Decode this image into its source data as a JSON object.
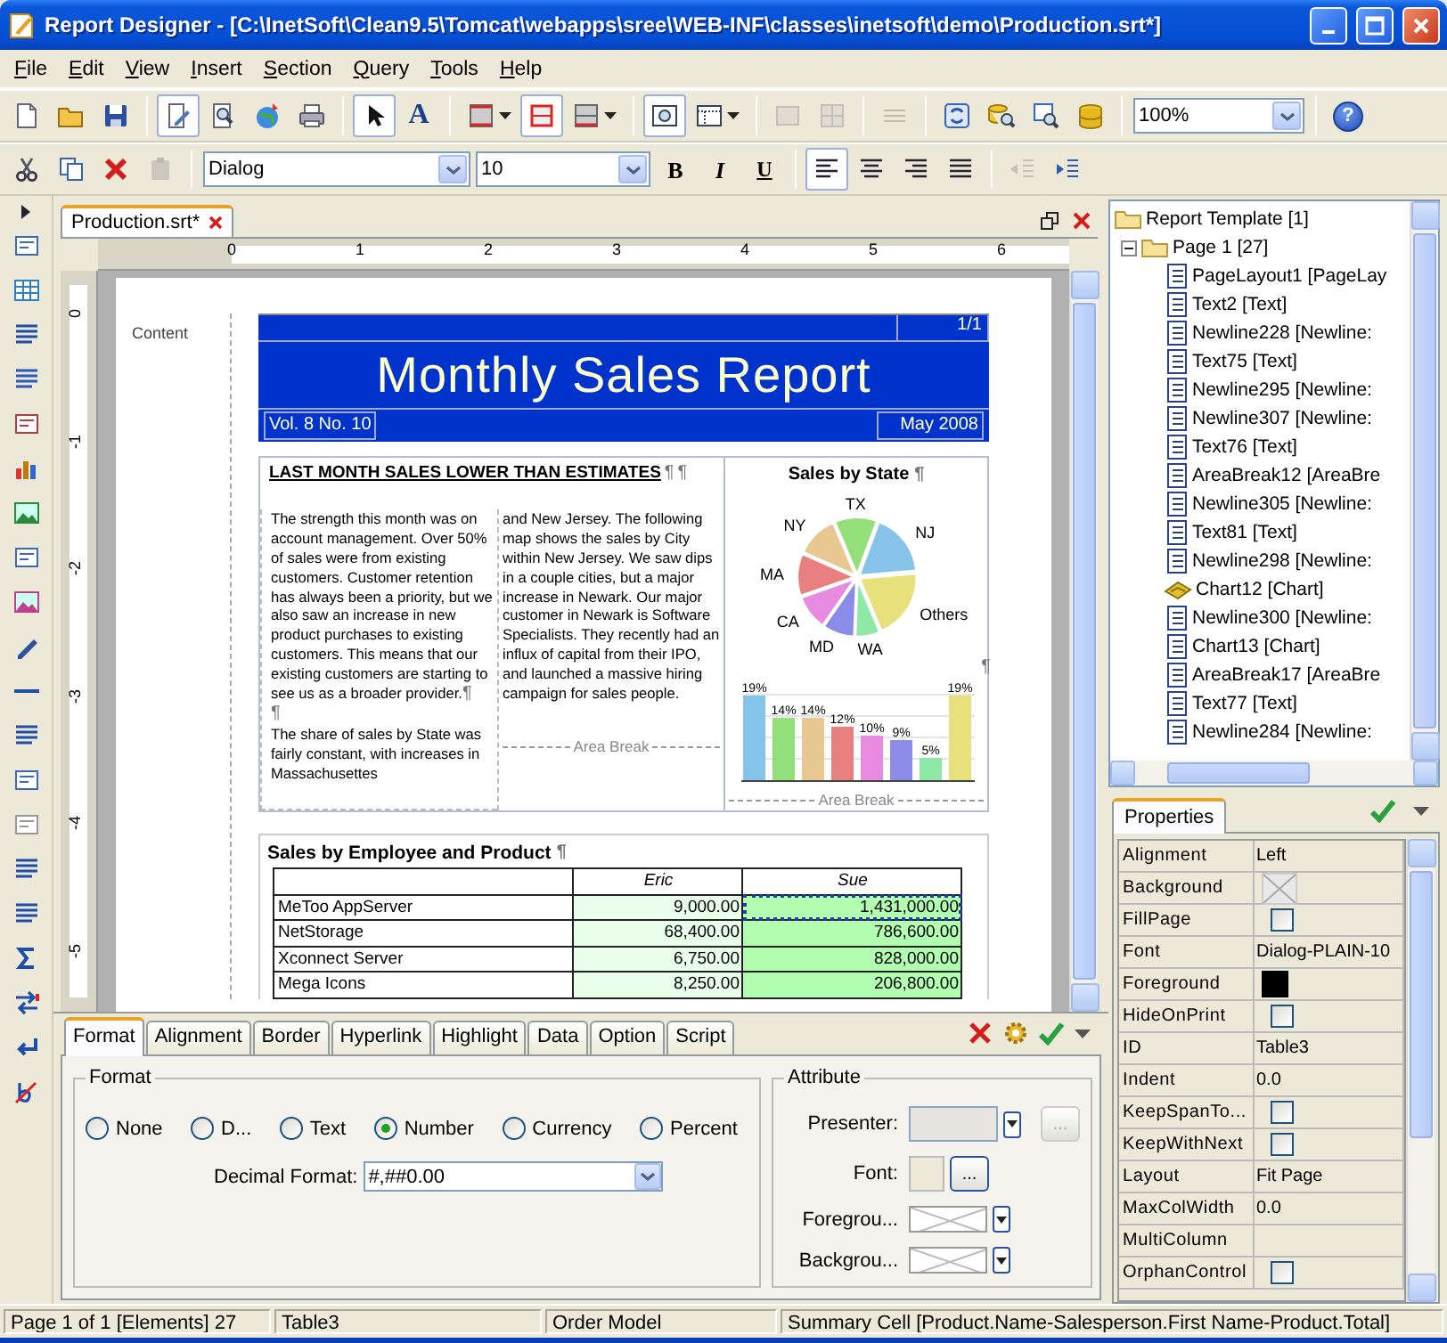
{
  "window": {
    "title": "Report Designer - [C:\\InetSoft\\Clean9.5\\Tomcat\\webapps\\sree\\WEB-INF\\classes\\inetsoft\\demo\\Production.srt*]"
  },
  "menu": [
    "File",
    "Edit",
    "View",
    "Insert",
    "Section",
    "Query",
    "Tools",
    "Help"
  ],
  "toolbar_1": [
    {
      "items": [
        {
          "kind": "new",
          "pressed": false,
          "disabled": false
        },
        {
          "kind": "open",
          "pressed": false,
          "disabled": false
        },
        {
          "kind": "save",
          "pressed": false,
          "disabled": false
        }
      ]
    },
    {
      "items": [
        {
          "kind": "design",
          "pressed": true,
          "disabled": false
        },
        {
          "kind": "preview",
          "pressed": false,
          "disabled": false
        },
        {
          "kind": "export",
          "pressed": false,
          "disabled": false
        },
        {
          "kind": "print",
          "pressed": false,
          "disabled": false
        }
      ]
    },
    {
      "items": [
        {
          "kind": "select",
          "pressed": true,
          "disabled": false
        },
        {
          "kind": "text_tool",
          "glyph": "A",
          "pressed": false,
          "disabled": false
        }
      ]
    },
    {
      "items": [
        {
          "kind": "row_border_menu",
          "pressed": false,
          "disabled": false
        },
        {
          "kind": "border_box",
          "pressed": true,
          "disabled": false
        },
        {
          "kind": "col_border_menu",
          "pressed": false,
          "disabled": false
        }
      ]
    },
    {
      "items": [
        {
          "kind": "preview_frame",
          "pressed": true,
          "disabled": false
        },
        {
          "kind": "layout_menu",
          "pressed": false,
          "disabled": false
        }
      ]
    },
    {
      "items": [
        {
          "kind": "merge",
          "pressed": false,
          "disabled": true
        },
        {
          "kind": "split",
          "pressed": false,
          "disabled": true
        }
      ]
    },
    {
      "items": [
        {
          "kind": "rows",
          "pressed": false,
          "disabled": true
        }
      ]
    },
    {
      "items": [
        {
          "kind": "refresh",
          "pressed": false,
          "disabled": false
        },
        {
          "kind": "query",
          "pressed": false,
          "disabled": false
        },
        {
          "kind": "browse",
          "pressed": false,
          "disabled": false
        },
        {
          "kind": "database",
          "pressed": false,
          "disabled": false
        }
      ]
    },
    {
      "items": [
        {
          "kind": "zoom_combo",
          "value": "100%",
          "pressed": false,
          "disabled": false
        }
      ]
    },
    {
      "items": [
        {
          "kind": "help",
          "glyph": "?",
          "pressed": false,
          "disabled": false
        }
      ]
    }
  ],
  "toolbar_2": [
    {
      "items": [
        {
          "kind": "cut",
          "pressed": false,
          "disabled": false
        },
        {
          "kind": "copy",
          "pressed": false,
          "disabled": false
        },
        {
          "kind": "delete",
          "pressed": false,
          "disabled": false
        },
        {
          "kind": "paste",
          "pressed": false,
          "disabled": true
        }
      ]
    },
    {
      "items": [
        {
          "kind": "font_combo",
          "value": "Dialog",
          "pressed": false,
          "disabled": false
        },
        {
          "kind": "size_combo",
          "value": "10",
          "pressed": false,
          "disabled": false
        },
        {
          "kind": "bold",
          "glyph": "B",
          "pressed": false,
          "disabled": false
        },
        {
          "kind": "italic",
          "glyph": "I",
          "pressed": false,
          "disabled": false
        },
        {
          "kind": "underline",
          "glyph": "U",
          "pressed": false,
          "disabled": false
        }
      ]
    },
    {
      "items": [
        {
          "kind": "align_left",
          "pressed": true,
          "disabled": false
        },
        {
          "kind": "align_center",
          "pressed": false,
          "disabled": false
        },
        {
          "kind": "align_right",
          "pressed": false,
          "disabled": false
        },
        {
          "kind": "justify",
          "pressed": false,
          "disabled": false
        }
      ]
    },
    {
      "items": [
        {
          "kind": "outdent",
          "pressed": false,
          "disabled": true
        },
        {
          "kind": "indent",
          "pressed": false,
          "disabled": false
        }
      ]
    }
  ],
  "editor": {
    "tab": {
      "label": "Production.srt*"
    },
    "ruler": {
      "horizontal": [
        "0",
        "1",
        "2",
        "3",
        "4",
        "5",
        "6"
      ],
      "vertical": [
        "0",
        "-1",
        "-2",
        "-3",
        "-4",
        "-5"
      ]
    },
    "report": {
      "margin_label": "Content",
      "page_number": "1/1",
      "title": "Monthly Sales Report",
      "volume": "Vol. 8 No. 10",
      "date": "May 2008",
      "headline": "LAST MONTH SALES LOWER THAN ESTIMATES",
      "headline_marks": [
        "¶",
        "¶"
      ],
      "column_1": [
        {
          "text": "The strength this month was on account management. Over 50% of sales were from existing customers. Customer retention has always been a priority, but we also saw an increase in new product purchases to existing customers. This means that our existing customers are starting to see us as a broader provider.",
          "mark": "¶"
        },
        {
          "mark": "¶"
        },
        {
          "text": "The share of sales by State was fairly constant, with increases in Massachusettes"
        }
      ],
      "column_2": {
        "text": "and New Jersey. The following map shows the sales by City within New Jersey. We saw dips in a couple cities, but a major increase in Newark. Our major customer in Newark is Software Specialists. They recently had an influx of capital from their IPO, and launched a massive hiring campaign for sales people.",
        "area_break": "Area Break"
      },
      "state_chart": {
        "title": "Sales by State",
        "mark": "¶",
        "side_mark": "¶",
        "pie_labels": [
          "TX",
          "NJ",
          "Others",
          "WA",
          "MD",
          "CA",
          "MA",
          "NY"
        ],
        "chart_data": {
          "type": "bar",
          "values": [
            19,
            14,
            14,
            12,
            10,
            9,
            5,
            19
          ],
          "value_labels": [
            "19%",
            "14%",
            "14%",
            "12%",
            "10%",
            "9%",
            "5%",
            "19%"
          ],
          "colors": [
            "#86c3e8",
            "#93e07a",
            "#e8c890",
            "#e88080",
            "#e88ae0",
            "#8c8ce8",
            "#8ee8a6",
            "#e8e07a"
          ]
        },
        "area_break": "Area Break"
      },
      "employee_table": {
        "title": "Sales by Employee and Product",
        "mark": "¶",
        "columns": [
          "Eric",
          "Sue"
        ],
        "rows": [
          {
            "product": "MeToo AppServer",
            "cells": [
              {
                "value": "9,000.00",
                "selected": false
              },
              {
                "value": "1,431,000.00",
                "selected": true
              }
            ]
          },
          {
            "product": "NetStorage",
            "cells": [
              {
                "value": "68,400.00",
                "selected": false
              },
              {
                "value": "786,600.00",
                "selected": false
              }
            ]
          },
          {
            "product": "Xconnect Server",
            "cells": [
              {
                "value": "6,750.00",
                "selected": false
              },
              {
                "value": "828,000.00",
                "selected": false
              }
            ]
          },
          {
            "product": "Mega Icons",
            "cells": [
              {
                "value": "8,250.00",
                "selected": false
              },
              {
                "value": "206,800.00",
                "selected": false
              }
            ]
          }
        ]
      }
    }
  },
  "format_panel": {
    "tabs": [
      {
        "label": "Format",
        "selected": true
      },
      {
        "label": "Alignment",
        "selected": false
      },
      {
        "label": "Border",
        "selected": false
      },
      {
        "label": "Hyperlink",
        "selected": false
      },
      {
        "label": "Highlight",
        "selected": false
      },
      {
        "label": "Data",
        "selected": false
      },
      {
        "label": "Option",
        "selected": false
      },
      {
        "label": "Script",
        "selected": false
      }
    ],
    "format_group": {
      "title": "Format",
      "options": [
        {
          "label": "None",
          "selected": false
        },
        {
          "label": "D...",
          "selected": false
        },
        {
          "label": "Text",
          "selected": false
        },
        {
          "label": "Number",
          "selected": true
        },
        {
          "label": "Currency",
          "selected": false
        },
        {
          "label": "Percent",
          "selected": false
        }
      ],
      "decimal_label": "Decimal Format:",
      "decimal_value": "#,##0.00"
    },
    "attribute_group": {
      "title": "Attribute",
      "fields": [
        {
          "label": "Presenter:",
          "kind": "presenter",
          "button_label": "...",
          "disabled": true
        },
        {
          "label": "Font:",
          "kind": "font",
          "button_label": "...",
          "disabled": false
        },
        {
          "label": "Foregrou...",
          "kind": "color",
          "disabled": false
        },
        {
          "label": "Backgrou...",
          "kind": "color",
          "disabled": false
        }
      ]
    }
  },
  "tree": [
    {
      "label": "Report Template [1]",
      "kind": "folder",
      "children": [
        {
          "label": "Page 1 [27]",
          "kind": "folder",
          "expanded": true,
          "children": [
            {
              "label": "PageLayout1 [PageLay",
              "kind": "element"
            },
            {
              "label": "Text2 [Text]",
              "kind": "element"
            },
            {
              "label": "Newline228 [Newline:",
              "kind": "element"
            },
            {
              "label": "Text75 [Text]",
              "kind": "element"
            },
            {
              "label": "Newline295 [Newline:",
              "kind": "element"
            },
            {
              "label": "Newline307 [Newline:",
              "kind": "element"
            },
            {
              "label": "Text76 [Text]",
              "kind": "element"
            },
            {
              "label": "AreaBreak12 [AreaBre",
              "kind": "element"
            },
            {
              "label": "Newline305 [Newline:",
              "kind": "element"
            },
            {
              "label": "Text81 [Text]",
              "kind": "element"
            },
            {
              "label": "Newline298 [Newline:",
              "kind": "element"
            },
            {
              "label": "Chart12 [Chart]",
              "kind": "chart"
            },
            {
              "label": "Newline300 [Newline:",
              "kind": "element"
            },
            {
              "label": "Chart13 [Chart]",
              "kind": "element"
            },
            {
              "label": "AreaBreak17 [AreaBre",
              "kind": "element"
            },
            {
              "label": "Text77 [Text]",
              "kind": "element"
            },
            {
              "label": "Newline284 [Newline:",
              "kind": "element"
            }
          ]
        }
      ]
    }
  ],
  "properties": {
    "tab": "Properties",
    "rows": [
      {
        "name": "Alignment",
        "kind": "text",
        "value": "Left"
      },
      {
        "name": "Background",
        "kind": "nocolor"
      },
      {
        "name": "FillPage",
        "kind": "checkbox",
        "checked": false
      },
      {
        "name": "Font",
        "kind": "text",
        "value": "Dialog-PLAIN-10"
      },
      {
        "name": "Foreground",
        "kind": "color",
        "color": "#000000"
      },
      {
        "name": "HideOnPrint",
        "kind": "checkbox",
        "checked": false
      },
      {
        "name": "ID",
        "kind": "text",
        "value": "Table3"
      },
      {
        "name": "Indent",
        "kind": "text",
        "value": "0.0"
      },
      {
        "name": "KeepSpanTo...",
        "kind": "checkbox",
        "checked": false
      },
      {
        "name": "KeepWithNext",
        "kind": "checkbox",
        "checked": false
      },
      {
        "name": "Layout",
        "kind": "text",
        "value": "Fit Page"
      },
      {
        "name": "MaxColWidth",
        "kind": "text",
        "value": "0.0"
      },
      {
        "name": "MultiColumn",
        "kind": "empty"
      },
      {
        "name": "OrphanControl",
        "kind": "checkbox",
        "checked": false
      }
    ]
  },
  "status_bar": [
    "Page 1 of 1  [Elements] 27",
    "Table3",
    "Order Model",
    "Summary Cell [Product.Name-Salesperson.First Name-Product.Total]"
  ]
}
